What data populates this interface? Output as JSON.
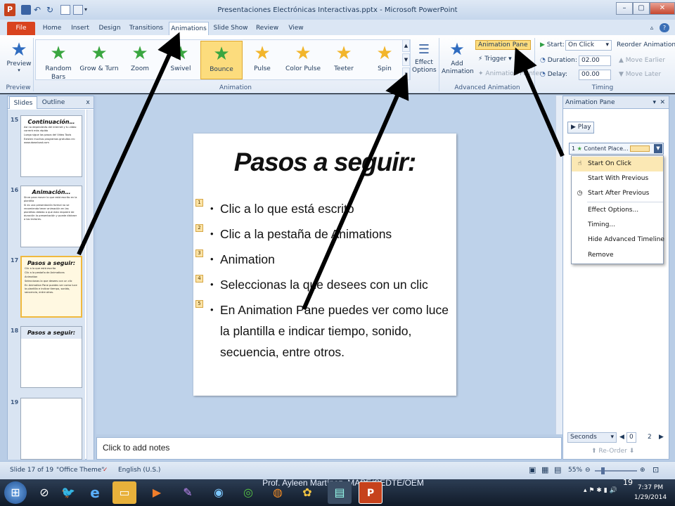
{
  "window": {
    "title": "Presentaciones Electrónicas Interactivas.pptx - Microsoft PowerPoint",
    "app_badge": "P",
    "min": "–",
    "max": "▢",
    "close": "✕"
  },
  "tabs": [
    "File",
    "Home",
    "Insert",
    "Design",
    "Transitions",
    "Animations",
    "Slide Show",
    "Review",
    "View"
  ],
  "ribbon": {
    "preview_label": "Preview",
    "preview_group": "Preview",
    "animation_group": "Animation",
    "effects": [
      {
        "label": "Random Bars",
        "color": "#3aa640"
      },
      {
        "label": "Grow & Turn",
        "color": "#3aa640"
      },
      {
        "label": "Zoom",
        "color": "#3aa640"
      },
      {
        "label": "Swivel",
        "color": "#3aa640"
      },
      {
        "label": "Bounce",
        "color": "#3aa640"
      },
      {
        "label": "Pulse",
        "color": "#f2b52b"
      },
      {
        "label": "Color Pulse",
        "color": "#f2b52b"
      },
      {
        "label": "Teeter",
        "color": "#f2b52b"
      },
      {
        "label": "Spin",
        "color": "#f2b52b"
      }
    ],
    "effect_options": "Effect Options",
    "add_animation": "Add Animation",
    "animation_pane": "Animation Pane",
    "trigger": "Trigger",
    "animation_painter": "Animation Painter",
    "advanced_group": "Advanced Animation",
    "start_label": "Start:",
    "start_value": "On Click",
    "duration_label": "Duration:",
    "duration_value": "02.00",
    "delay_label": "Delay:",
    "delay_value": "00.00",
    "reorder_title": "Reorder Animation",
    "move_earlier": "Move Earlier",
    "move_later": "Move Later",
    "timing_group": "Timing"
  },
  "slides_panel": {
    "tab_slides": "Slides",
    "tab_outline": "Outline",
    "close": "x",
    "thumbs": [
      {
        "num": "15",
        "title": "Continuación…",
        "lines": [
          "Así no dependerás del internet y tu video correrá más rápido",
          "Luego sigue los pasos del Video Tools",
          "Existen muchos programas gratuitos en: www.download.com"
        ]
      },
      {
        "num": "16",
        "title": "Animación…",
        "lines": [
          "Sirve para mover lo que está escrito en la plantilla",
          "Si es una presentación formal no se recomienda tener animación en las plantillas debido a que esta requiere de duración la presentación y puede distraer a los lectores."
        ]
      },
      {
        "num": "17",
        "title": "Pasos a seguir:",
        "lines": [
          "Clic a lo que está escrito",
          "Clic a la pestaña de Animations",
          "Animation",
          "Seleccionas la que desees con un clic",
          "En Animation Pane puedes ver como luce la plantilla e indicar tiempo, sonido, secuencia, entre otros."
        ]
      },
      {
        "num": "18",
        "title": "Pasos a seguir:",
        "lines": []
      },
      {
        "num": "19",
        "title": "",
        "lines": []
      }
    ]
  },
  "slide": {
    "title": "Pasos a seguir:",
    "bullets": [
      {
        "tag": "1",
        "text": "Clic a lo que está escrito"
      },
      {
        "tag": "2",
        "text": "Clic a la pestaña de Animations"
      },
      {
        "tag": "3",
        "text": "Animation"
      },
      {
        "tag": "4",
        "text": "Seleccionas la que desees con un clic"
      },
      {
        "tag": "5",
        "text": "En Animation Pane puedes ver como luce la plantilla e indicar tiempo, sonido, secuencia, entre otros."
      }
    ]
  },
  "notes_placeholder": "Click to add notes",
  "anim_pane": {
    "title": "Animation Pane",
    "play": "Play",
    "item_num": "1",
    "item_label": "Content Place...",
    "menu": [
      "Start On Click",
      "Start With Previous",
      "Start After Previous",
      "Effect Options...",
      "Timing...",
      "Hide Advanced Timeline",
      "Remove"
    ],
    "seconds": "Seconds",
    "zero": "0",
    "two": "2",
    "reorder": "Re-Order"
  },
  "status": {
    "slide_of": "Slide 17 of 19",
    "theme": "\"Office Theme\"",
    "language": "English (U.S.)",
    "zoom": "55%"
  },
  "taskbar": {
    "footer_note": "Prof. Ayleen Martínez, MAPE/CEDTE/OEM",
    "page_number": "19",
    "time": "7:37 PM",
    "date": "1/29/2014"
  }
}
